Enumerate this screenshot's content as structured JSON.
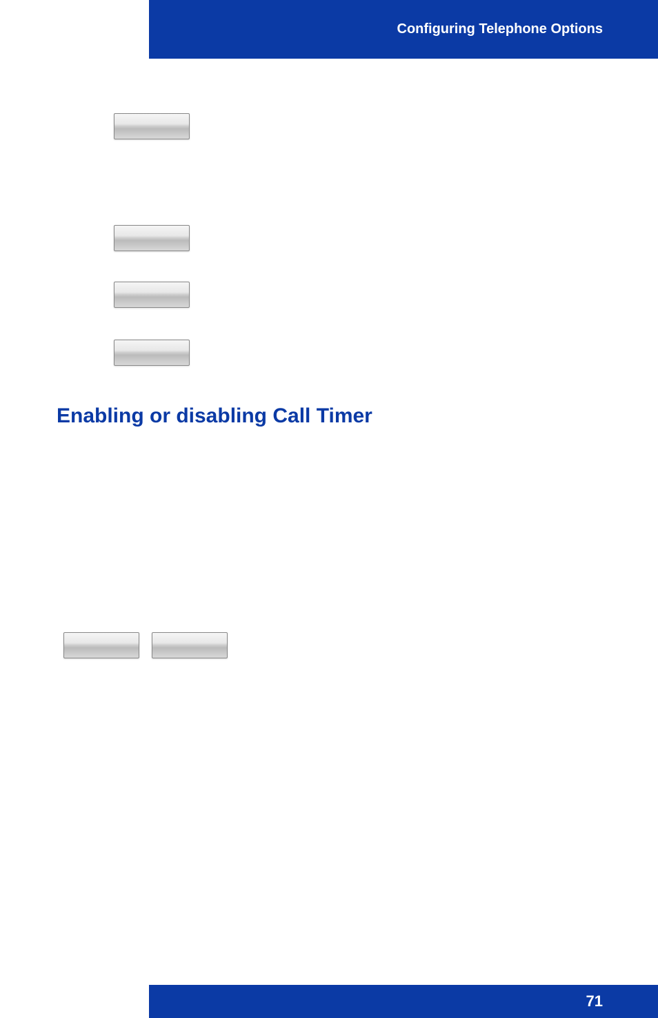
{
  "header": {
    "title": "Configuring Telephone Options"
  },
  "footer": {
    "page_number": "71"
  },
  "sections": {
    "call_timer": {
      "heading": "Enabling or disabling Call Timer"
    }
  }
}
